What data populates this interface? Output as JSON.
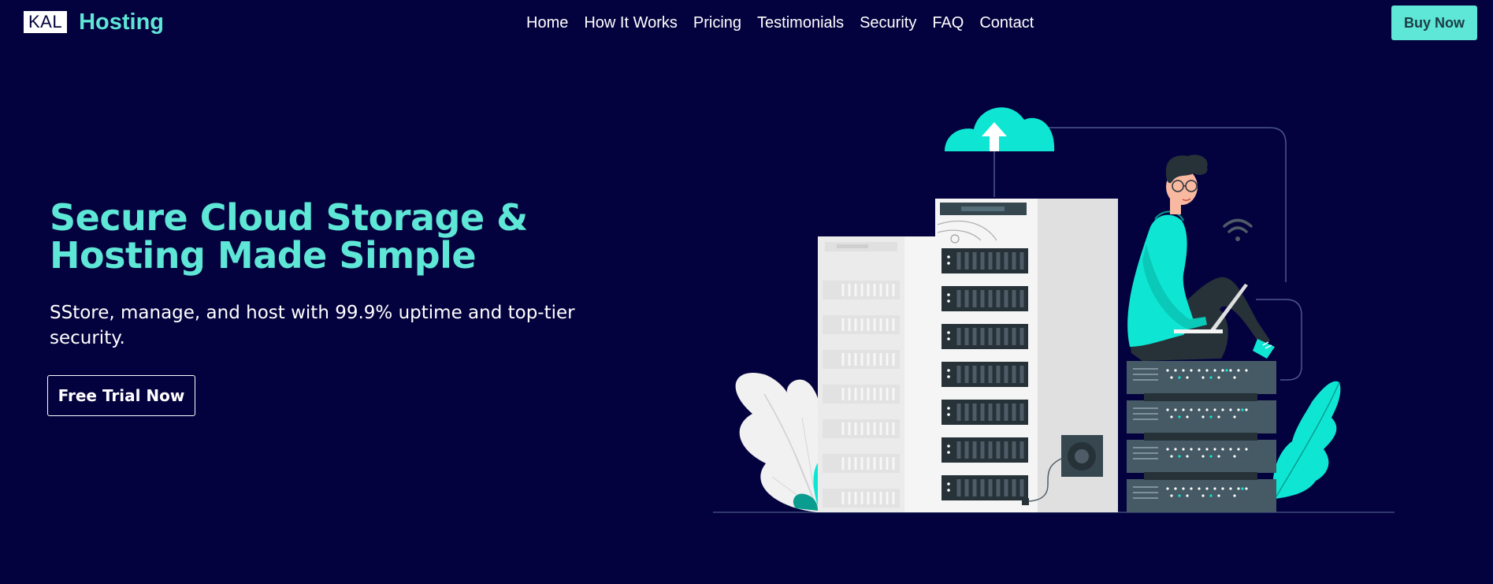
{
  "brand": {
    "box_text": "KAL",
    "name": "Hosting"
  },
  "nav": {
    "links": [
      {
        "label": "Home"
      },
      {
        "label": "How It Works"
      },
      {
        "label": "Pricing"
      },
      {
        "label": "Testimonials"
      },
      {
        "label": "Security"
      },
      {
        "label": "FAQ"
      },
      {
        "label": "Contact"
      }
    ],
    "buy_label": "Buy Now"
  },
  "hero": {
    "title": "Secure Cloud Storage & Hosting Made Simple",
    "subtitle": "SStore, manage, and host with 99.9% uptime and top-tier security.",
    "cta_label": "Free Trial Now"
  },
  "colors": {
    "background": "#04023e",
    "accent": "#5ee6d6",
    "illustration_teal": "#0ee6d3",
    "server_dark": "#37474f"
  },
  "icons": [
    "cloud-upload-icon",
    "wifi-icon"
  ]
}
